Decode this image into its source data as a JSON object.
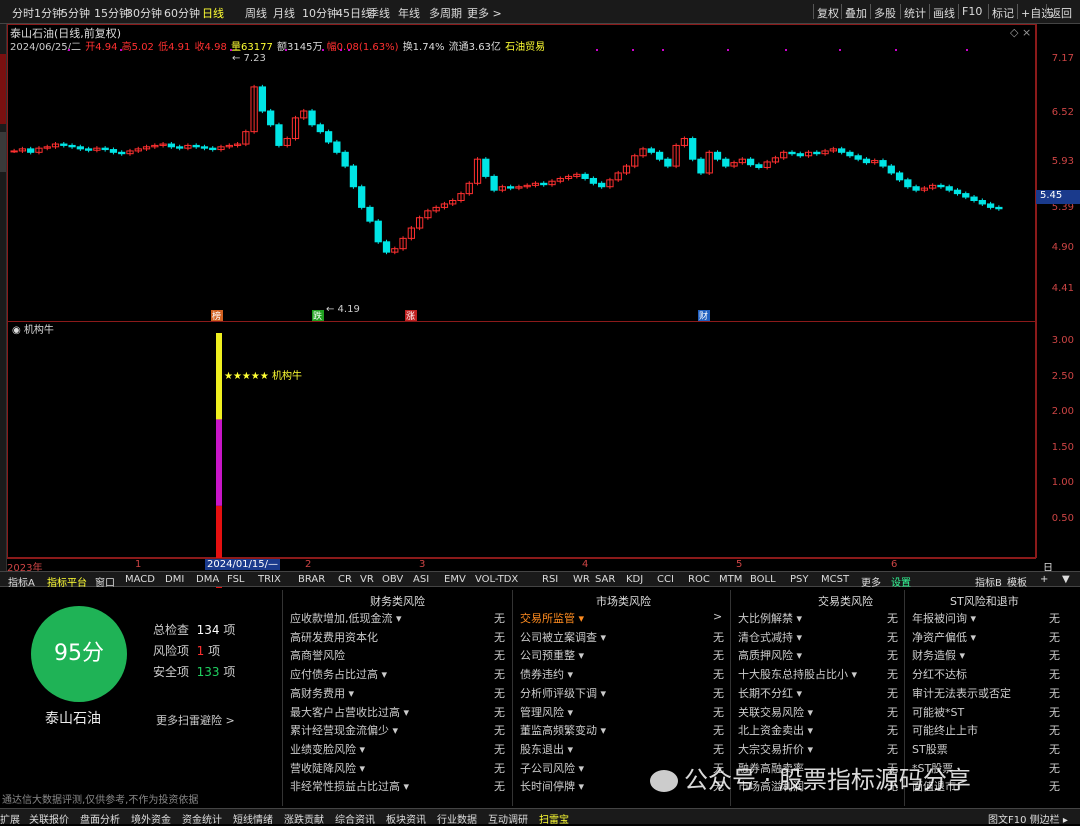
{
  "periods": [
    "分时",
    "1分钟",
    "5分钟",
    "15分钟",
    "30分钟",
    "60分钟",
    "日线",
    "周线",
    "月线",
    "10分钟",
    "45日线",
    "季线",
    "年线",
    "多周期",
    "更多 >"
  ],
  "selected_period": "日线",
  "right_tools": [
    "复权",
    "叠加",
    "多股",
    "统计",
    "画线",
    "F10",
    "标记",
    "+自选",
    "返回"
  ],
  "stock": {
    "title": "泰山石油(日线,前复权)",
    "date": "2024/06/25/二",
    "open": "开4.94",
    "high": "高5.02",
    "low": "低4.91",
    "close": "收4.98",
    "volume": "量63177",
    "amount": "额3145万",
    "change": "幅0.08(1.63%)",
    "turnover": "换1.74%",
    "float_cap": "流通3.63亿",
    "sector": "石油贸易"
  },
  "price_ticks": [
    "7.17",
    "6.52",
    "5.93",
    "5.39",
    "4.90",
    "4.41"
  ],
  "current_price": "5.45",
  "high_marker": "7.23",
  "low_marker": "4.19",
  "event_labels": [
    "榜",
    "跌",
    "涨",
    "财"
  ],
  "indicator": {
    "name": "机构牛",
    "label": "★★★★★ 机构牛",
    "ticks": [
      "3.00",
      "2.50",
      "2.00",
      "1.50",
      "1.00",
      "0.50"
    ],
    "value": 3.0,
    "colors": [
      "#e51010",
      "#c816c8",
      "#f0f020"
    ]
  },
  "time_axis": [
    "2023年",
    "1",
    "2024/01/15/—",
    "2",
    "3",
    "4",
    "5",
    "6",
    "日线"
  ],
  "indicator_tabs": [
    "指标A",
    "指标平台",
    "窗口",
    "MACD",
    "DMI",
    "DMA",
    "FSL",
    "TRIX",
    "BRAR",
    "CR",
    "VR",
    "OBV",
    "ASI",
    "EMV",
    "VOL-TDX",
    "RSI",
    "WR",
    "SAR",
    "KDJ",
    "CCI",
    "ROC",
    "MTM",
    "BOLL",
    "PSY",
    "MCST",
    "更多",
    "设置"
  ],
  "indicator_right_tabs": [
    "指标B",
    "模板",
    "+",
    "▼"
  ],
  "scan": {
    "score": "95分",
    "name": "泰山石油",
    "total_label": "总检查",
    "total_value": "134",
    "risk_label": "风险项",
    "risk_value": "1",
    "safe_label": "安全项",
    "safe_value": "133",
    "unit": "项",
    "more": "更多扫雷避险 >",
    "disclaimer": "通达信大数据评测,仅供参考,不作为投资依据"
  },
  "risk_columns": [
    {
      "title": "财务类风险",
      "rows": [
        "应收款增加,低现金流 ▾",
        "高研发费用资本化",
        "高商誉风险",
        "应付债务占比过高 ▾",
        "高财务费用 ▾",
        "最大客户占营收比过高 ▾",
        "累计经营现金流偏少 ▾",
        "业绩变脸风险 ▾",
        "营收陡降风险 ▾",
        "非经常性损益占比过高 ▾"
      ],
      "values": [
        "无",
        "无",
        "无",
        "无",
        "无",
        "无",
        "无",
        "无",
        "无",
        "无"
      ]
    },
    {
      "title": "市场类风险",
      "rows": [
        "交易所监管 ▾",
        "公司被立案调查 ▾",
        "公司预重整 ▾",
        "债券违约 ▾",
        "分析师评级下调 ▾",
        "管理风险 ▾",
        "董监高频繁变动 ▾",
        "股东退出 ▾",
        "子公司风险 ▾",
        "长时间停牌 ▾"
      ],
      "values": [
        ">",
        "无",
        "无",
        "无",
        "无",
        "无",
        "无",
        "无",
        "无",
        "无"
      ]
    },
    {
      "title": "交易类风险",
      "rows": [
        "大比例解禁 ▾",
        "清仓式减持 ▾",
        "高质押风险 ▾",
        "十大股东总持股占比小 ▾",
        "长期不分红 ▾",
        "关联交易风险 ▾",
        "北上资金卖出 ▾",
        "大宗交易折价 ▾",
        "融券高融卖率",
        "市场高溢利润"
      ],
      "values": [
        "无",
        "无",
        "无",
        "无",
        "无",
        "无",
        "无",
        "无",
        "无",
        "无"
      ]
    },
    {
      "title": "ST风险和退市",
      "rows": [
        "年报被问询 ▾",
        "净资产偏低 ▾",
        "财务造假 ▾",
        "分红不达标",
        "审计无法表示或否定",
        "可能被*ST",
        "可能终止上市",
        "ST股票",
        "*ST股票",
        "面值退市"
      ],
      "values": [
        "无",
        "无",
        "无",
        "无",
        "无",
        "无",
        "无",
        "无",
        "无",
        "无"
      ]
    }
  ],
  "watermark": "公众号 · 股票指标源码分享",
  "footer_tabs": [
    "扩展",
    "关联报价",
    "盘面分析",
    "境外资金",
    "资金统计",
    "短线情绪",
    "涨跌贡献",
    "综合资讯",
    "板块资讯",
    "行业数据",
    "互动调研",
    "扫雷宝"
  ],
  "footer_right": "图文F10 侧边栏 ▸",
  "colors": {
    "up": "#ff3030",
    "down": "#00e5e5",
    "accent": "#ff3"
  }
}
